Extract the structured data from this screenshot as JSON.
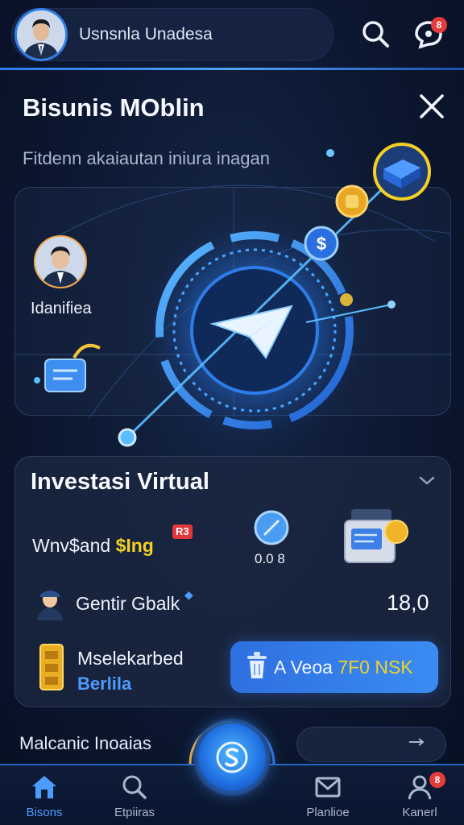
{
  "header": {
    "user_name": "Usnsnla Unadesa",
    "search_icon": "search-icon",
    "notif_icon": "chat-notification-icon",
    "notif_badge": "8"
  },
  "page": {
    "title": "Bisunis MOblin",
    "subtitle": "Fitdenn akaiautan iniura inagan"
  },
  "hero": {
    "person_label": "Idanifiea",
    "coin_symbol": "$"
  },
  "investasi": {
    "title": "Investasi Virtual",
    "row1_label_a": "Wnv$and ",
    "row1_label_b": "$Ing",
    "row1_tag": "R3",
    "row1_small_value": "0.0 8",
    "row2_label": "Gentir Gbalk",
    "row2_value": "18,0",
    "row3_label": "Mselekarbed",
    "row3_sub": "Berlila",
    "action_label_a": "A Veoa ",
    "action_label_b": "7F0 ",
    "action_label_c": "NSK"
  },
  "bottom": {
    "strip_label": "Malcanic Inoaias",
    "nav": [
      {
        "label": "Bisons",
        "icon": "home-icon"
      },
      {
        "label": "Etpiiras",
        "icon": "search-icon"
      },
      {
        "label": "Planlioe",
        "icon": "mail-icon"
      },
      {
        "label": "Kanerl",
        "icon": "user-icon"
      }
    ],
    "profile_badge": "8"
  },
  "colors": {
    "accent": "#2f7de8",
    "highlight": "#f2d024",
    "badge": "#e53b3b"
  }
}
